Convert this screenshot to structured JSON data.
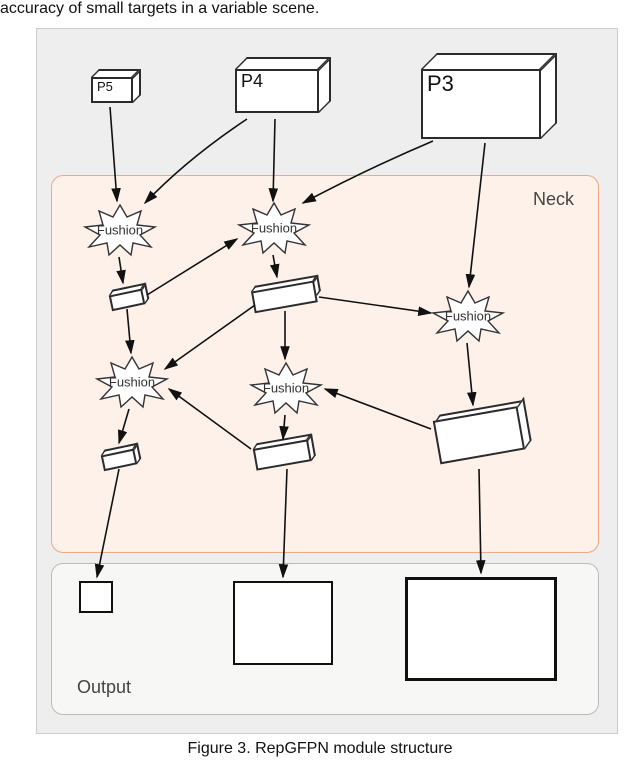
{
  "crop_text": "accuracy of small targets in a variable scene.",
  "caption": "Figure 3. RepGFPN module structure",
  "inputs": {
    "p5": "P5",
    "p4": "P4",
    "p3": "P3"
  },
  "fusion_label": "Fushion",
  "regions": {
    "neck": "Neck",
    "output": "Output"
  }
}
